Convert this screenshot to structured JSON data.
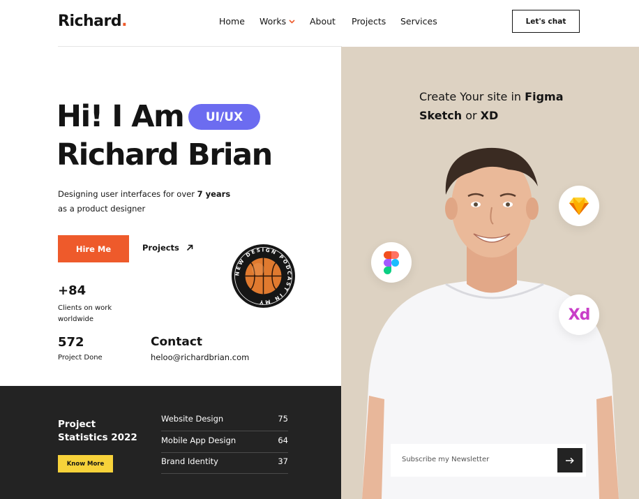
{
  "header": {
    "logo": "Richard",
    "logo_dot": ".",
    "nav": [
      "Home",
      "Works",
      "About",
      "Projects",
      "Services"
    ],
    "cta": "Let's chat"
  },
  "hero": {
    "greeting": "Hi! I Am",
    "role_badge": "UI/UX",
    "name": "Richard Brian",
    "description_prefix": "Designing user interfaces for over",
    "description_years": "7 years",
    "description_suffix": "as a product designer",
    "hire_label": "Hire Me",
    "projects_label": "Projects"
  },
  "badge": {
    "text": "NEW DESIGN PODCAST IN MY"
  },
  "stats": {
    "clients_value": "+84",
    "clients_label": "Clients on work worldwide",
    "done_value": "572",
    "done_label": "Project Done"
  },
  "contact": {
    "title": "Contact",
    "email": "heloo@richardbrian.com"
  },
  "project_stats": {
    "title": "Project Statistics 2022",
    "button": "Know More",
    "rows": [
      {
        "name": "Website Design",
        "value": "75"
      },
      {
        "name": "Mobile App Design",
        "value": "64"
      },
      {
        "name": "Brand Identity",
        "value": "37"
      }
    ]
  },
  "tagline": {
    "prefix": "Create Your site in",
    "tool1": "Figma",
    "tool2": "Sketch",
    "joiner": "or",
    "tool3": "XD"
  },
  "tools": {
    "xd_label": "Xd"
  },
  "newsletter": {
    "placeholder": "Subscribe my Newsletter"
  },
  "colors": {
    "accent": "#ee5a2b",
    "pill": "#6c6cf0",
    "dark": "#232323",
    "beige": "#ddd2c2",
    "yellow": "#f7d23a"
  }
}
